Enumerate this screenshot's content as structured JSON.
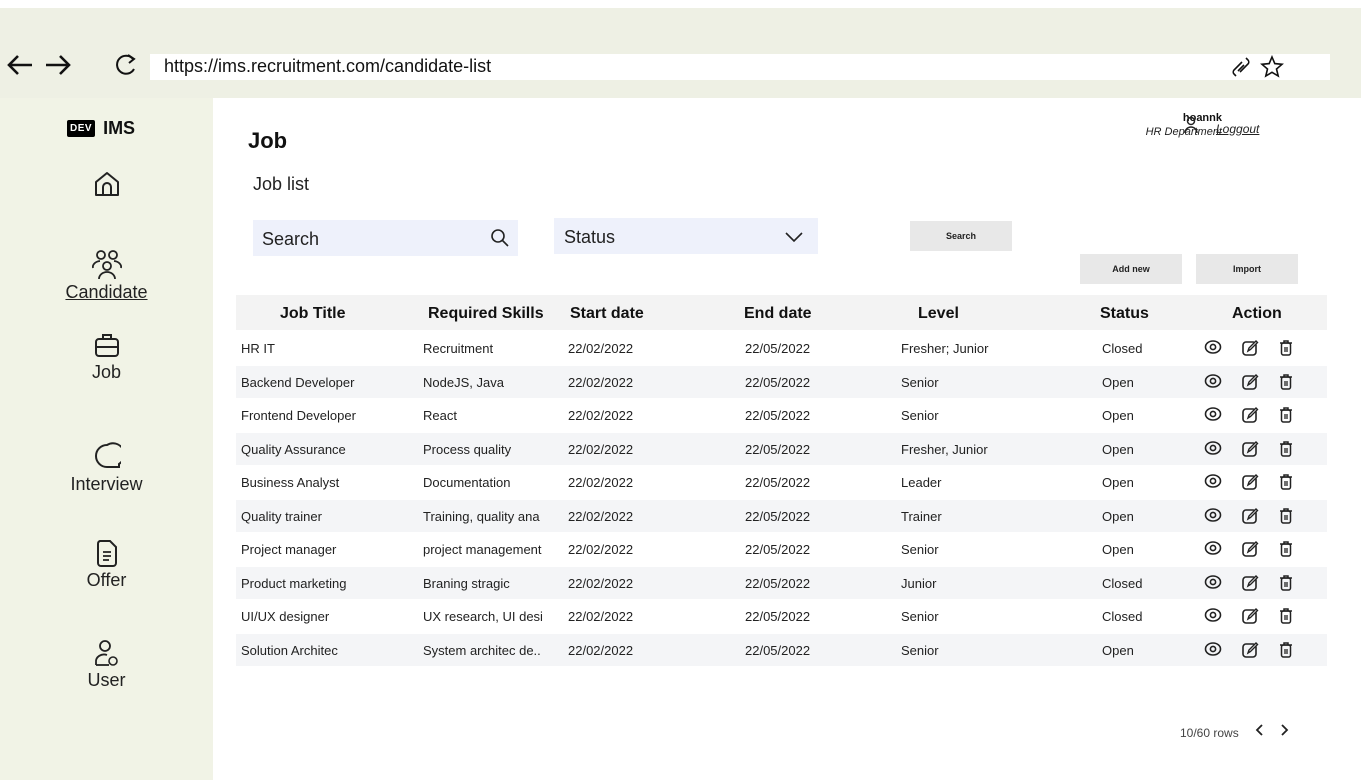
{
  "browser": {
    "url": "https://ims.recruitment.com/candidate-list",
    "back_icon": "arrow-left-icon",
    "forward_icon": "arrow-right-icon",
    "reload_icon": "reload-icon"
  },
  "sidebar": {
    "logo_badge": "DEV",
    "logo_text": "IMS",
    "items": [
      {
        "label": "",
        "icon": "home-icon"
      },
      {
        "label": "Candidate",
        "icon": "people-icon"
      },
      {
        "label": "Job",
        "icon": "briefcase-icon"
      },
      {
        "label": "Interview",
        "icon": "chat-icon"
      },
      {
        "label": "Offer",
        "icon": "document-icon"
      },
      {
        "label": "User",
        "icon": "user-gear-icon"
      }
    ]
  },
  "header": {
    "title": "Job",
    "subtitle": "Job list",
    "user_name": "hoannk",
    "user_dept": "HR Department",
    "logout_label": "Loggout"
  },
  "filters": {
    "search_placeholder": "Search",
    "status_placeholder": "Status",
    "search_button": "Search",
    "add_new_button": "Add new",
    "import_button": "Import"
  },
  "table": {
    "headers": [
      "Job Title",
      "Required Skills",
      "Start date",
      "End date",
      "Level",
      "Status",
      "Action"
    ],
    "rows": [
      {
        "title": "HR IT",
        "skills": "Recruitment",
        "start": "22/02/2022",
        "end": "22/05/2022",
        "level": "Fresher; Junior",
        "status": "Closed"
      },
      {
        "title": "Backend  Developer",
        "skills": "NodeJS, Java",
        "start": "22/02/2022",
        "end": "22/05/2022",
        "level": "Senior",
        "status": "Open"
      },
      {
        "title": "Frontend Developer",
        "skills": "React",
        "start": "22/02/2022",
        "end": "22/05/2022",
        "level": "Senior",
        "status": "Open"
      },
      {
        "title": "Quality Assurance",
        "skills": "Process quality",
        "start": "22/02/2022",
        "end": "22/05/2022",
        "level": "Fresher, Junior",
        "status": "Open"
      },
      {
        "title": "Business Analyst",
        "skills": "Documentation",
        "start": "22/02/2022",
        "end": "22/05/2022",
        "level": "Leader",
        "status": "Open"
      },
      {
        "title": "Quality trainer",
        "skills": "Training, quality ana",
        "start": "22/02/2022",
        "end": "22/05/2022",
        "level": "Trainer",
        "status": "Open"
      },
      {
        "title": "Project manager",
        "skills": "project management",
        "start": "22/02/2022",
        "end": "22/05/2022",
        "level": "Senior",
        "status": "Open"
      },
      {
        "title": "Product marketing",
        "skills": "Braning stragic",
        "start": "22/02/2022",
        "end": "22/05/2022",
        "level": "Junior",
        "status": "Closed"
      },
      {
        "title": "UI/UX designer",
        "skills": "UX research, UI desi",
        "start": "22/02/2022",
        "end": "22/05/2022",
        "level": "Senior",
        "status": "Closed"
      },
      {
        "title": "Solution Architec",
        "skills": "System architec de..",
        "start": "22/02/2022",
        "end": "22/05/2022",
        "level": "Senior",
        "status": "Open"
      }
    ]
  },
  "pagination": {
    "rows_label": "10/60 rows",
    "prev": "<",
    "next": ">"
  }
}
